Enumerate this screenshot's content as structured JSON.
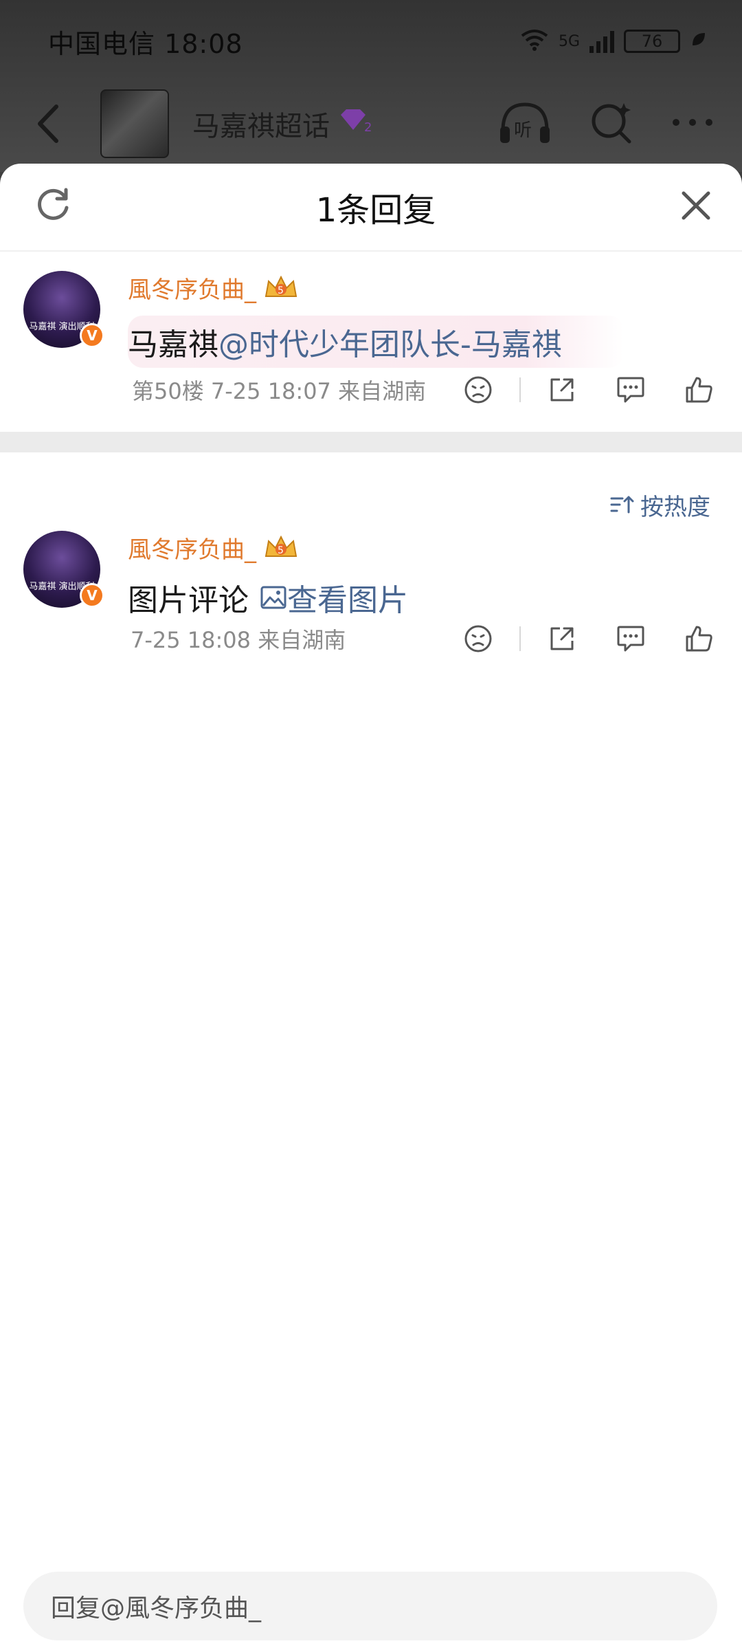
{
  "status_bar": {
    "carrier_time": "中国电信 18:08",
    "wifi_label": "6",
    "network_label": "5G",
    "battery": "76"
  },
  "topbar": {
    "title": "马嘉祺超话",
    "badge_level": "2",
    "listen_label": "听"
  },
  "sheet": {
    "title": "1条回复"
  },
  "main_comment": {
    "username": "風冬序负曲_",
    "crown_level": "5",
    "avatar_text": "马嘉祺 演出顺利",
    "text_prefix": "马嘉祺",
    "mention": "@时代少年团队长-马嘉祺",
    "meta": "第50楼 7-25 18:07 来自湖南"
  },
  "sort": {
    "label": "按热度"
  },
  "reply": {
    "username": "風冬序负曲_",
    "crown_level": "5",
    "avatar_text": "马嘉祺 演出顺利",
    "text": "图片评论",
    "link": "查看图片",
    "meta": "7-25 18:08 来自湖南"
  },
  "reply_input": {
    "placeholder": "回复@風冬序负曲_"
  },
  "colors": {
    "username": "#e07a2e",
    "link": "#4a6791",
    "badge": "#f47a1f"
  }
}
